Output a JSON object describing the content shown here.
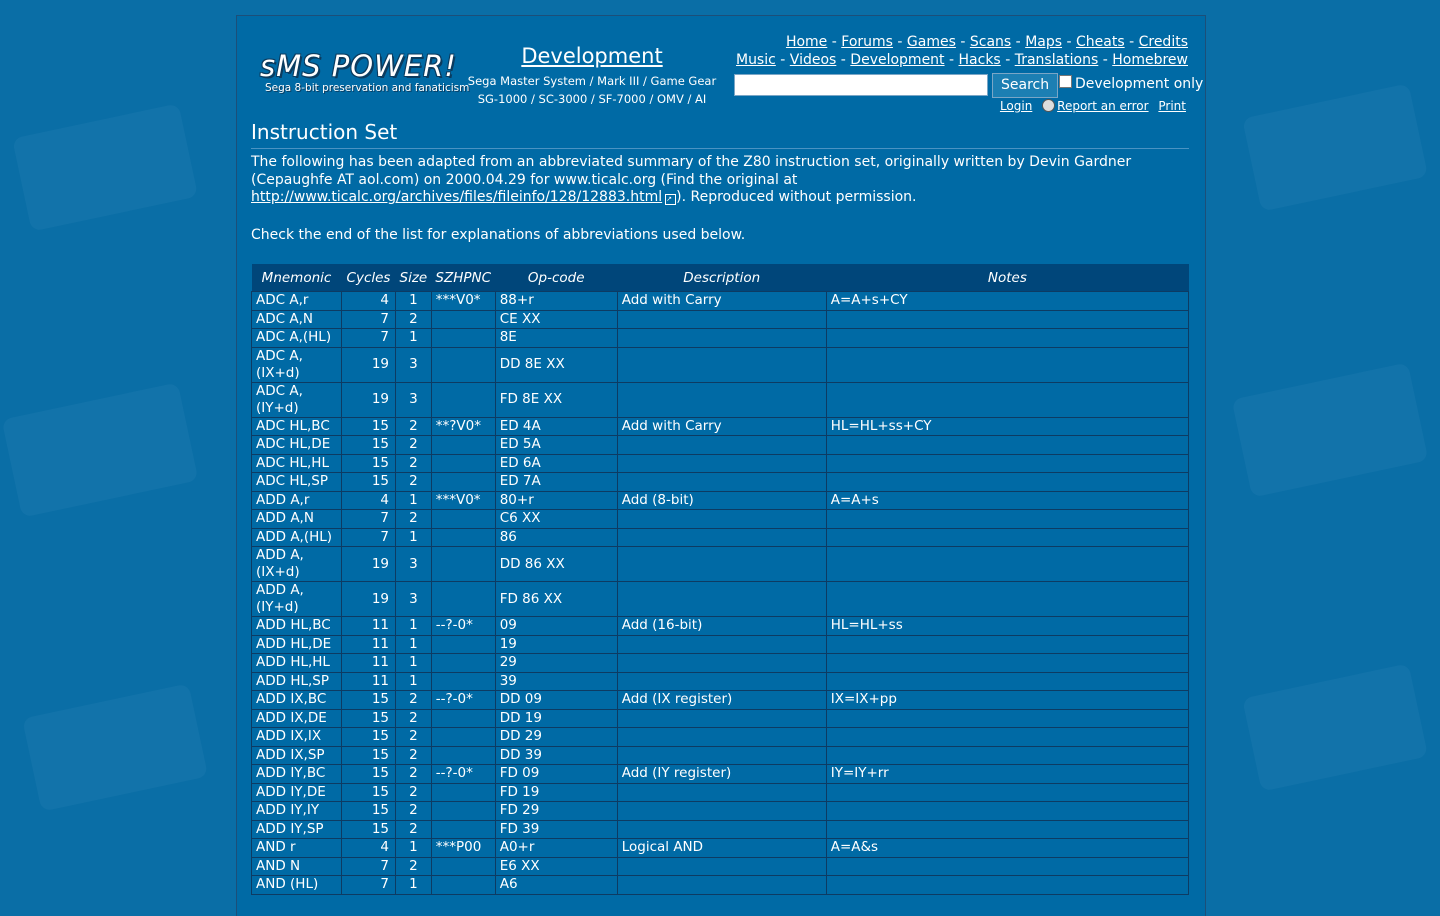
{
  "logo": {
    "wordmark": "sMS POWER!",
    "tagline": "Sega 8-bit preservation and fanaticism"
  },
  "section": {
    "title": "Development",
    "line1": "Sega Master System / Mark III / Game Gear",
    "line2": "SG-1000 / SC-3000 / SF-7000 / OMV / AI"
  },
  "nav": {
    "row1": [
      "Home",
      "Forums",
      "Games",
      "Scans",
      "Maps",
      "Cheats",
      "Credits"
    ],
    "row2": [
      "Music",
      "Videos",
      "Development",
      "Hacks",
      "Translations",
      "Homebrew"
    ]
  },
  "search": {
    "value": "",
    "button": "Search",
    "checkbox_label": "Development only",
    "checked": false
  },
  "util": {
    "login": "Login",
    "report": "Report an error",
    "print": "Print"
  },
  "page_title": "Instruction Set",
  "intro": {
    "text_before": "The following has been adapted from an abbreviated summary of the Z80 instruction set, originally written by Devin Gardner (Cepaughfe AT aol.com) on 2000.04.29 for www.ticalc.org (Find the original at ",
    "link": "http://www.ticalc.org/archives/files/fileinfo/128/12883.html",
    "text_after": "). Reproduced without permission.",
    "note": "Check the end of the list for explanations of abbreviations used below."
  },
  "table": {
    "headers": [
      "Mnemonic",
      "Cycles",
      "Size",
      "SZHPNC",
      "Op-code",
      "Description",
      "Notes"
    ],
    "rows": [
      [
        "ADC A,r",
        "4",
        "1",
        "***V0*",
        "88+r",
        "Add with Carry",
        "A=A+s+CY"
      ],
      [
        "ADC A,N",
        "7",
        "2",
        "",
        "CE XX",
        "",
        ""
      ],
      [
        "ADC A,(HL)",
        "7",
        "1",
        "",
        "8E",
        "",
        ""
      ],
      [
        "ADC A,(IX+d)",
        "19",
        "3",
        "",
        "DD 8E XX",
        "",
        ""
      ],
      [
        "ADC A,(IY+d)",
        "19",
        "3",
        "",
        "FD 8E XX",
        "",
        ""
      ],
      [
        "ADC HL,BC",
        "15",
        "2",
        "**?V0*",
        "ED 4A",
        "Add with Carry",
        "HL=HL+ss+CY"
      ],
      [
        "ADC HL,DE",
        "15",
        "2",
        "",
        "ED 5A",
        "",
        ""
      ],
      [
        "ADC HL,HL",
        "15",
        "2",
        "",
        "ED 6A",
        "",
        ""
      ],
      [
        "ADC HL,SP",
        "15",
        "2",
        "",
        "ED 7A",
        "",
        ""
      ],
      [
        "ADD A,r",
        "4",
        "1",
        "***V0*",
        "80+r",
        "Add (8-bit)",
        "A=A+s"
      ],
      [
        "ADD A,N",
        "7",
        "2",
        "",
        "C6 XX",
        "",
        ""
      ],
      [
        "ADD A,(HL)",
        "7",
        "1",
        "",
        "86",
        "",
        ""
      ],
      [
        "ADD A,(IX+d)",
        "19",
        "3",
        "",
        "DD 86 XX",
        "",
        ""
      ],
      [
        "ADD A,(IY+d)",
        "19",
        "3",
        "",
        "FD 86 XX",
        "",
        ""
      ],
      [
        "ADD HL,BC",
        "11",
        "1",
        "--?-0*",
        "09",
        "Add (16-bit)",
        "HL=HL+ss"
      ],
      [
        "ADD HL,DE",
        "11",
        "1",
        "",
        "19",
        "",
        ""
      ],
      [
        "ADD HL,HL",
        "11",
        "1",
        "",
        "29",
        "",
        ""
      ],
      [
        "ADD HL,SP",
        "11",
        "1",
        "",
        "39",
        "",
        ""
      ],
      [
        "ADD IX,BC",
        "15",
        "2",
        "--?-0*",
        "DD 09",
        "Add (IX register)",
        "IX=IX+pp"
      ],
      [
        "ADD IX,DE",
        "15",
        "2",
        "",
        "DD 19",
        "",
        ""
      ],
      [
        "ADD IX,IX",
        "15",
        "2",
        "",
        "DD 29",
        "",
        ""
      ],
      [
        "ADD IX,SP",
        "15",
        "2",
        "",
        "DD 39",
        "",
        ""
      ],
      [
        "ADD IY,BC",
        "15",
        "2",
        "--?-0*",
        "FD 09",
        "Add (IY register)",
        "IY=IY+rr"
      ],
      [
        "ADD IY,DE",
        "15",
        "2",
        "",
        "FD 19",
        "",
        ""
      ],
      [
        "ADD IY,IY",
        "15",
        "2",
        "",
        "FD 29",
        "",
        ""
      ],
      [
        "ADD IY,SP",
        "15",
        "2",
        "",
        "FD 39",
        "",
        ""
      ],
      [
        "AND r",
        "4",
        "1",
        "***P00",
        "A0+r",
        "Logical AND",
        "A=A&s"
      ],
      [
        "AND N",
        "7",
        "2",
        "",
        "E6 XX",
        "",
        ""
      ],
      [
        "AND (HL)",
        "7",
        "1",
        "",
        "A6",
        "",
        ""
      ]
    ]
  }
}
